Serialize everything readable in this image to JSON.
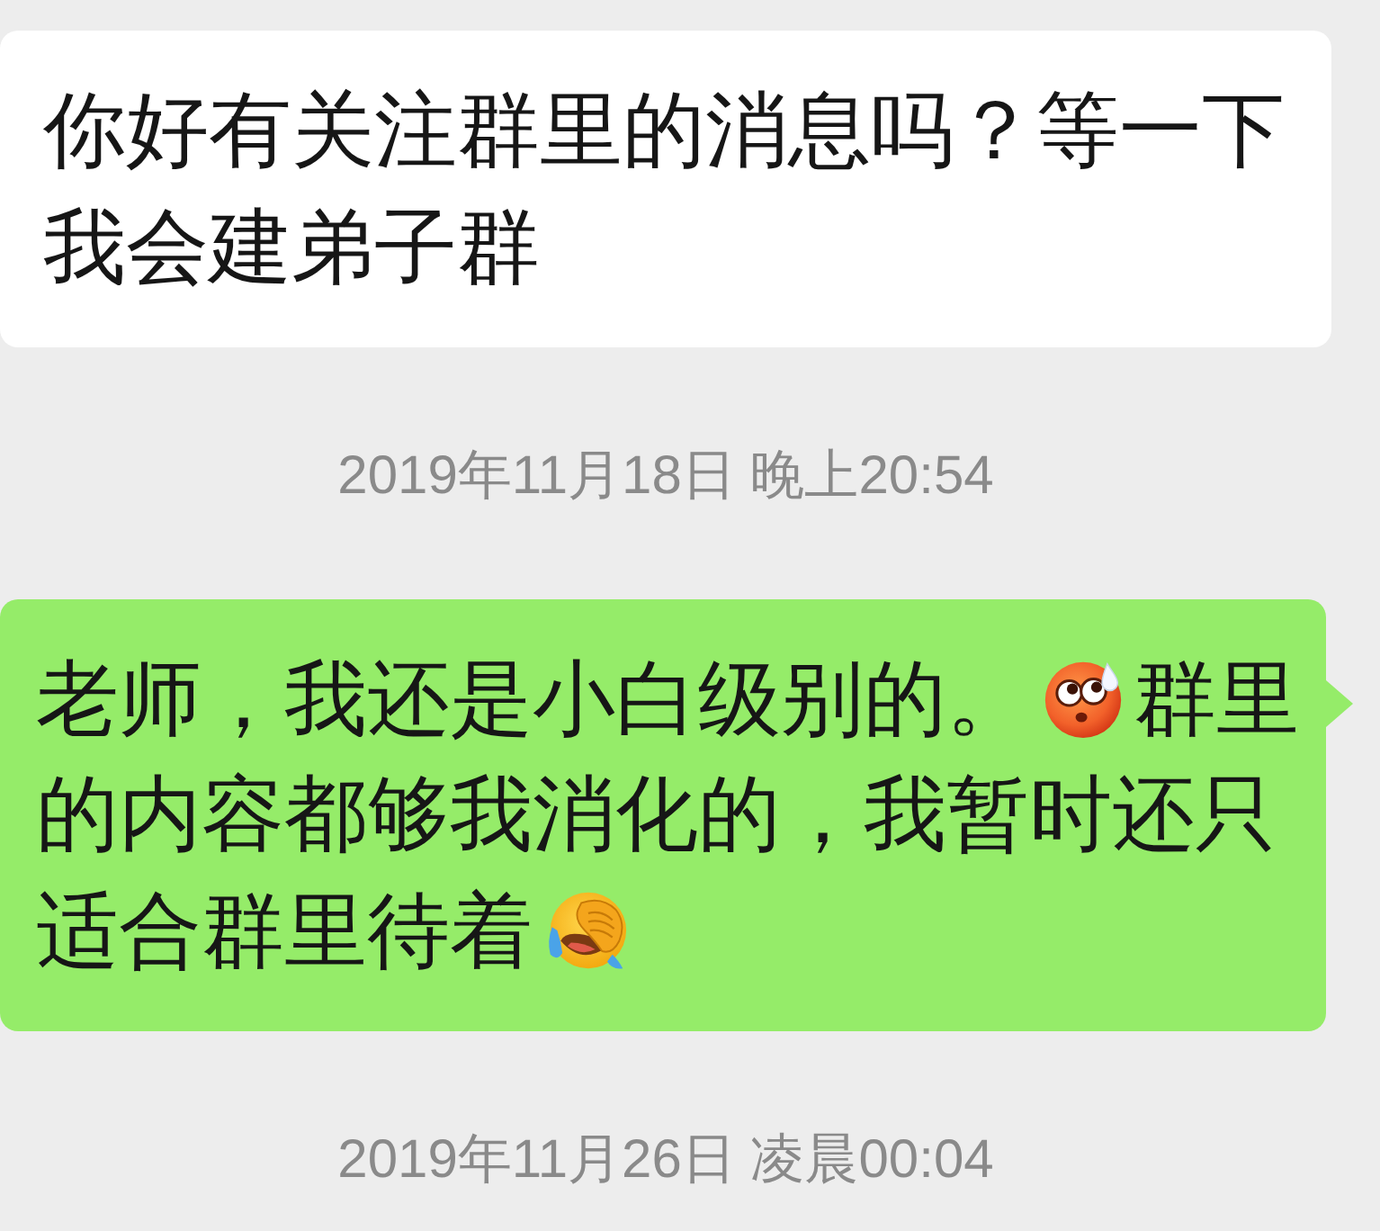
{
  "messages": [
    {
      "kind": "received",
      "text": "你好有关注群里的消息吗？等一下我会建弟子群"
    },
    {
      "kind": "timestamp",
      "text": "2019年11月18日 晚上20:54"
    },
    {
      "kind": "sent",
      "lines": [
        [
          {
            "kind": "text",
            "text": "老师，我还是小白级别的。"
          },
          {
            "kind": "flushed"
          },
          {
            "kind": "text",
            "text": "群里"
          }
        ],
        [
          {
            "kind": "text",
            "text": "的内容都够我消化的，我暂时还只"
          }
        ],
        [
          {
            "kind": "text",
            "text": "适合群里待着"
          },
          {
            "kind": "facepalm"
          }
        ]
      ]
    },
    {
      "kind": "timestamp",
      "text": "2019年11月26日 凌晨00:04"
    }
  ]
}
